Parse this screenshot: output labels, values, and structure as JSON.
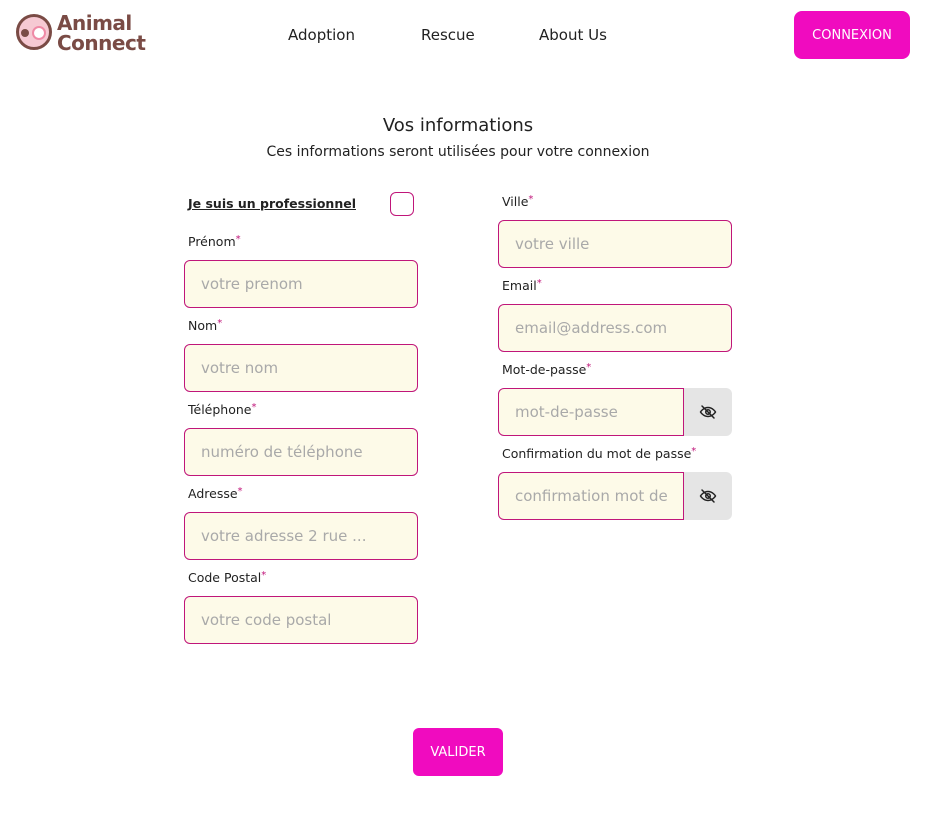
{
  "header": {
    "logo_line1": "Animal",
    "logo_line2": "Connect",
    "nav": [
      "Adoption",
      "Rescue",
      "About Us"
    ],
    "login_label": "CONNEXION"
  },
  "form": {
    "title": "Vos informations",
    "subtitle": "Ces informations seront utilisées pour votre connexion",
    "professional_label": "Je suis un professionnel",
    "professional_checked": false,
    "fields": {
      "prenom": {
        "label": "Prénom",
        "placeholder": "votre prenom",
        "value": ""
      },
      "nom": {
        "label": "Nom",
        "placeholder": "votre nom",
        "value": ""
      },
      "telephone": {
        "label": "Téléphone",
        "placeholder": "numéro de téléphone",
        "value": ""
      },
      "adresse": {
        "label": "Adresse",
        "placeholder": "votre adresse 2 rue ...",
        "value": ""
      },
      "code_postal": {
        "label": "Code Postal",
        "placeholder": "votre code postal",
        "value": ""
      },
      "ville": {
        "label": "Ville",
        "placeholder": "votre ville",
        "value": ""
      },
      "email": {
        "label": "Email",
        "placeholder": "email@address.com",
        "value": ""
      },
      "password": {
        "label": "Mot-de-passe",
        "placeholder": "mot-de-passe",
        "value": ""
      },
      "password_confirm": {
        "label": "Confirmation du mot de passe",
        "placeholder": "confirmation mot de passe",
        "value": ""
      }
    },
    "required_mark": "*",
    "submit_label": "VALIDER"
  },
  "icons": {
    "logo": "paw-logo-icon",
    "eye": "eye-slash-icon"
  },
  "colors": {
    "accent": "#f00bbf",
    "field_border": "#c0167a",
    "field_bg": "#fdfae8",
    "brand_brown": "#7a4b45"
  }
}
